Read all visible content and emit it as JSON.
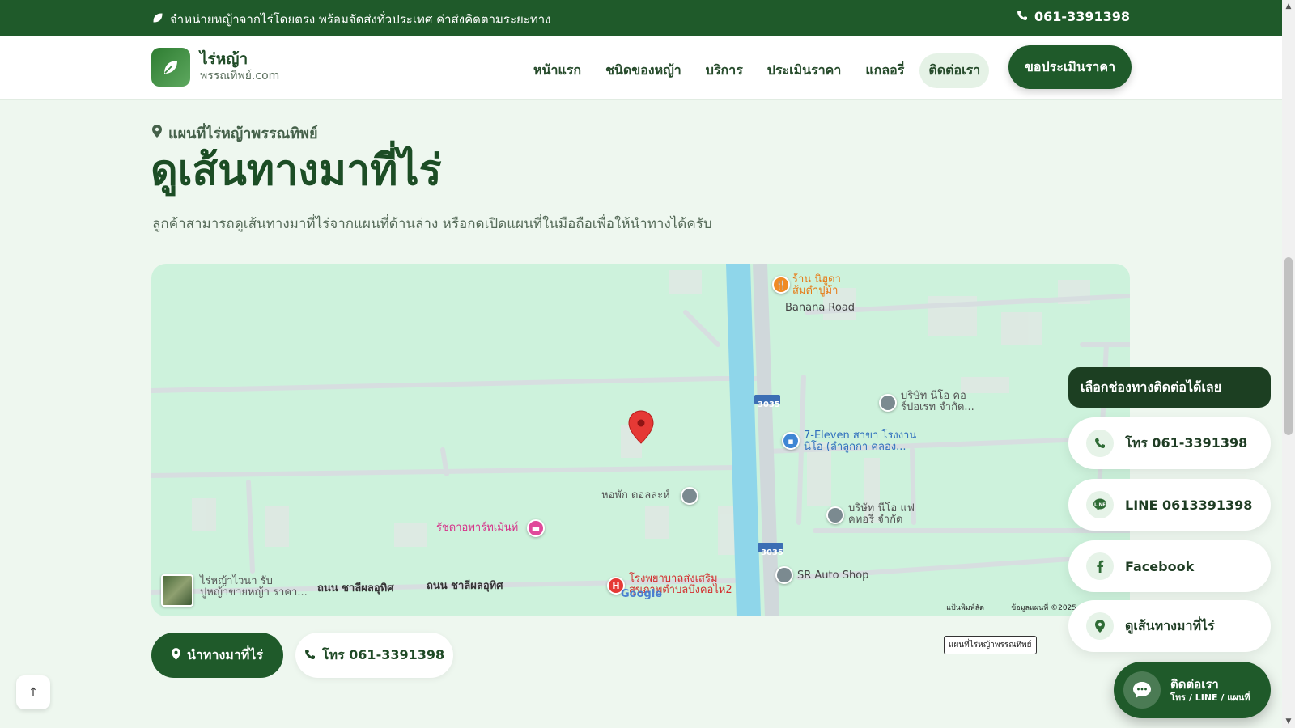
{
  "topbar": {
    "announcement": "จำหน่ายหญ้าจากไร่โดยตรง พร้อมจัดส่งทั่วประเทศ ค่าส่งคิดตามระยะทาง",
    "phone": "061-3391398"
  },
  "header": {
    "logo_name": "ไร่หญ้า",
    "logo_domain": "พรรณทิพย์.com",
    "nav": [
      {
        "label": "หน้าแรก"
      },
      {
        "label": "ชนิดของหญ้า"
      },
      {
        "label": "บริการ"
      },
      {
        "label": "ประเมินราคา"
      },
      {
        "label": "แกลอรี่"
      },
      {
        "label": "ติดต่อเรา",
        "active": true
      }
    ],
    "cta_label": "ขอประเมินราคา"
  },
  "section": {
    "eyebrow": "แผนที่ไร่หญ้าพรรณทิพย์",
    "title": "ดูเส้นทางมาที่ไร่",
    "subtitle": "ลูกค้าสามารถดูเส้นทางมาที่ไร่จากแผนที่ด้านล่าง หรือกดเปิดแผนที่ในมือถือเพื่อให้นำทางได้ครับ"
  },
  "map": {
    "labels": {
      "restaurant": "ร้าน นิฮูดา\nส้มตำปูม้า",
      "banana_road": "Banana Road",
      "route_3035_a": "3035",
      "route_3035_b": "3035",
      "company_neo": "บริษัท นีโอ คอ\nร์ปอเรท จำกัด...",
      "seven_eleven": "7-Eleven สาขา โรงงาน\nนีโอ (ลำลูกกา คลอง...",
      "dorm": "หอพัก ดอลละห์",
      "company_neo2": "บริษัท นีโอ แฟ\nคทอรี่ จำกัด",
      "apartment": "รัชดาอพาร์ทเม้นท์",
      "hospital": "โรงพยาบาลส่งเสริม\nสุขภาพตำบลบึงคอไห2",
      "sr_auto": "SR Auto Shop",
      "farm": "ไร่หญ้าไวนา รับ\nปูหญ้าขายหญ้า ราคา...",
      "road_1": "ถนน ชาลีผลอุทิศ",
      "road_2": "ถนน ชาลีผลอุทิศ",
      "google": "Google",
      "attr_keyboard": "แป้นพิมพ์ลัด",
      "attr_data": "ข้อมูลแผนที่ ©2025"
    },
    "caption": "แผนที่ไร่หญ้าพรรณทิพย์"
  },
  "actions": {
    "navigate_label": "นำทางมาที่ไร่",
    "call_label": "โทร 061-3391398"
  },
  "contact_panel": {
    "heading": "เลือกช่องทางติดต่อได้เลย",
    "items": [
      {
        "icon": "phone-icon",
        "label": "โทร 061-3391398"
      },
      {
        "icon": "line-icon",
        "label": "LINE 0613391398"
      },
      {
        "icon": "facebook-icon",
        "label": "Facebook"
      },
      {
        "icon": "map-pin-icon",
        "label": "ดูเส้นทางมาที่ไร่"
      }
    ]
  },
  "fab": {
    "line1": "ติดต่อเรา",
    "line2": "โทร / LINE / แผนที่"
  },
  "back_to_top": "↑",
  "colors": {
    "brand_dark": "#1f5a2a",
    "brand_darker": "#1c3f22",
    "page_bg": "#eef7ef",
    "map_bg": "#cdf2dc",
    "canal": "#8fd6ea",
    "pin_red": "#e53935"
  }
}
